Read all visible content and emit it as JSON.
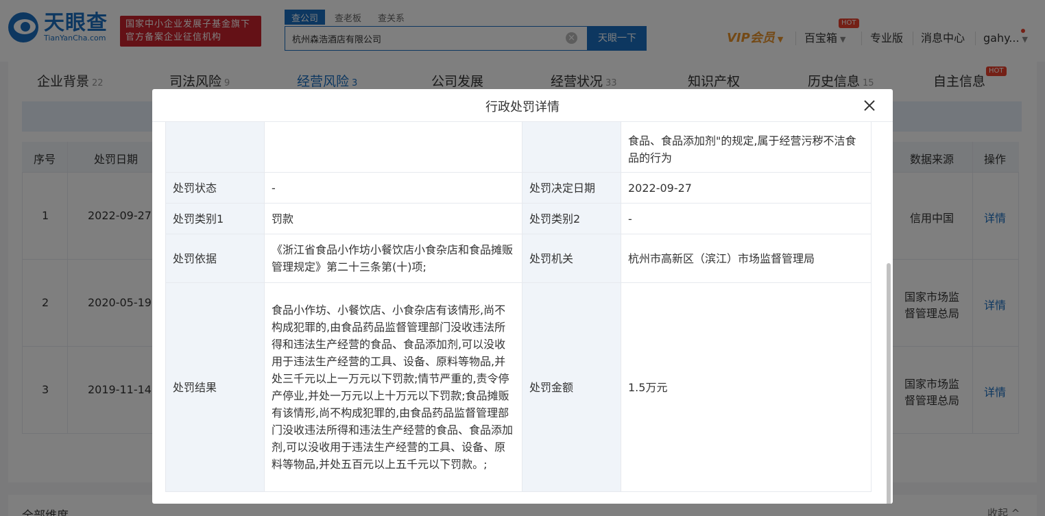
{
  "header": {
    "logo_cn": "天眼查",
    "logo_en": "TianYanCha.com",
    "badge_line1": "国家中小企业发展子基金旗下",
    "badge_line2": "官方备案企业征信机构",
    "search_tabs": [
      "查公司",
      "查老板",
      "查关系"
    ],
    "search_value": "杭州森浩酒店有限公司",
    "search_button": "天眼一下",
    "vip": "VIP会员",
    "baibaoxiang": "百宝箱",
    "hot": "HOT",
    "pro": "专业版",
    "messages": "消息中心",
    "user": "gahy..."
  },
  "tabs": [
    {
      "label": "企业背景",
      "count": "22"
    },
    {
      "label": "司法风险",
      "count": "9"
    },
    {
      "label": "经营风险",
      "count": "3"
    },
    {
      "label": "公司发展",
      "count": ""
    },
    {
      "label": "经营状况",
      "count": "33"
    },
    {
      "label": "知识产权",
      "count": ""
    },
    {
      "label": "历史信息",
      "count": "15"
    },
    {
      "label": "自主信息",
      "count": ""
    }
  ],
  "table": {
    "headers": {
      "no": "序号",
      "date": "处罚日期",
      "source": "数据来源",
      "action": "操作"
    },
    "rows": [
      {
        "no": "1",
        "date": "2022-09-27",
        "source1": "信用中国",
        "source2": "",
        "action": "详情"
      },
      {
        "no": "2",
        "date": "2020-05-19",
        "source1": "国家市场监",
        "source2": "督管理总局",
        "action": "详情"
      },
      {
        "no": "3",
        "date": "2019-11-14",
        "source1": "国家市场监",
        "source2": "督管理总局",
        "action": "详情"
      }
    ]
  },
  "bottom": {
    "left": "全部维度",
    "right": "收起 ^"
  },
  "modal": {
    "title": "行政处罚详情",
    "top_reason": "后\"應有开设\"形成形象或否德合住恶作用的食品、食品添加剂\"的规定,属于经营污秽不洁食品的行为",
    "top_reason_visible": "食品、食品添加剂\"的规定,属于经营污秽不洁食品的行为",
    "rows": [
      {
        "l1": "处罚状态",
        "v1": "-",
        "l2": "处罚决定日期",
        "v2": "2022-09-27"
      },
      {
        "l1": "处罚类别1",
        "v1": "罚款",
        "l2": "处罚类别2",
        "v2": "-"
      },
      {
        "l1": "处罚依据",
        "v1": "《浙江省食品小作坊小餐饮店小食杂店和食品摊贩管理规定》第二十三条第(十)项;",
        "l2": "处罚机关",
        "v2": "杭州市高新区（滨江）市场监督管理局"
      },
      {
        "l1": "处罚结果",
        "v1": "食品小作坊、小餐饮店、小食杂店有该情形,尚不构成犯罪的,由食品药品监督管理部门没收违法所得和违法生产经营的食品、食品添加剂,可以没收用于违法生产经营的工具、设备、原料等物品,并处三千元以上一万元以下罚款;情节严重的,责令停产停业,并处一万元以上十万元以下罚款;食品摊贩有该情形,尚不构成犯罪的,由食品药品监督管理部门没收违法所得和违法生产经营的食品、食品添加剂,可以没收用于违法生产经营的工具、设备、原料等物品,并处五百元以上五千元以下罚款。;",
        "l2": "处罚金额",
        "v2": "1.5万元"
      }
    ]
  }
}
